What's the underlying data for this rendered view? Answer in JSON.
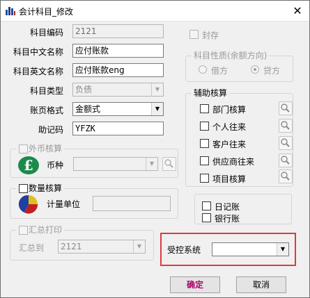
{
  "window": {
    "title": "会计科目_修改",
    "close_label": "✕"
  },
  "form": {
    "code": {
      "label": "科目编码",
      "value": "2121"
    },
    "cn_name": {
      "label": "科目中文名称",
      "value": "应付账款"
    },
    "en_name": {
      "label": "科目英文名称",
      "value": "应付账款eng"
    },
    "type": {
      "label": "科目类型",
      "value": "负债"
    },
    "page_format": {
      "label": "账页格式",
      "value": "金额式"
    },
    "mnemonic": {
      "label": "助记码",
      "value": "YFZK"
    }
  },
  "sealed": {
    "label": "封存"
  },
  "nature": {
    "title": "科目性质(余额方向)",
    "debit": "借方",
    "credit": "贷方",
    "selected": "credit"
  },
  "aux": {
    "title": "辅助核算",
    "items": [
      "部门核算",
      "个人往来",
      "客户往来",
      "供应商往来",
      "项目核算"
    ]
  },
  "foreign": {
    "title": "外币核算",
    "currency_label": "币种",
    "currency_value": ""
  },
  "quantity": {
    "title": "数量核算",
    "unit_label": "计量单位",
    "unit_value": ""
  },
  "ledger": {
    "journal": "日记账",
    "bank": "银行账"
  },
  "summary": {
    "title": "汇总打印",
    "to_label": "汇总到",
    "to_value": "2121"
  },
  "control": {
    "label": "受控系统",
    "value": ""
  },
  "buttons": {
    "ok": "确定",
    "cancel": "取消"
  },
  "colors": {
    "highlight_border": "#e03a3a",
    "ok_text": "#b0006a"
  }
}
